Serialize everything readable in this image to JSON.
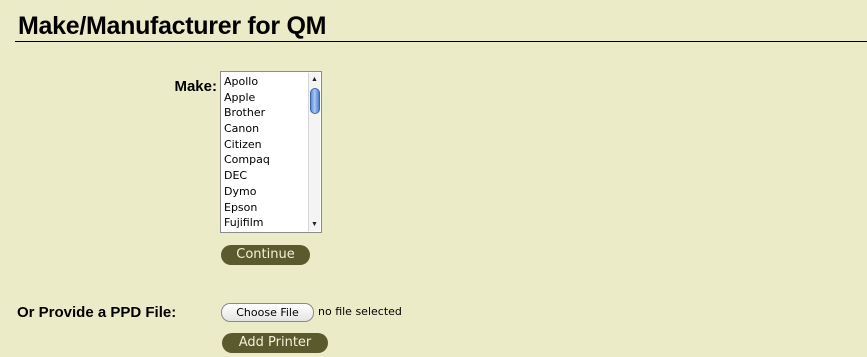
{
  "page": {
    "title": "Make/Manufacturer for QM"
  },
  "make_form": {
    "label": "Make:",
    "options": [
      "Apollo",
      "Apple",
      "Brother",
      "Canon",
      "Citizen",
      "Compaq",
      "DEC",
      "Dymo",
      "Epson",
      "Fujifilm"
    ],
    "continue_label": "Continue"
  },
  "ppd_form": {
    "label": "Or Provide a PPD File:",
    "choose_file_label": "Choose File",
    "file_status": "no file selected",
    "add_printer_label": "Add Printer"
  },
  "icons": {
    "scroll_up": "scroll-up-arrow-icon",
    "scroll_down": "scroll-down-arrow-icon"
  },
  "colors": {
    "background": "#ecebc8",
    "button_bg": "#5b5a2e",
    "button_text": "#f3f0d6",
    "scroll_thumb": "#5d8cd8"
  }
}
